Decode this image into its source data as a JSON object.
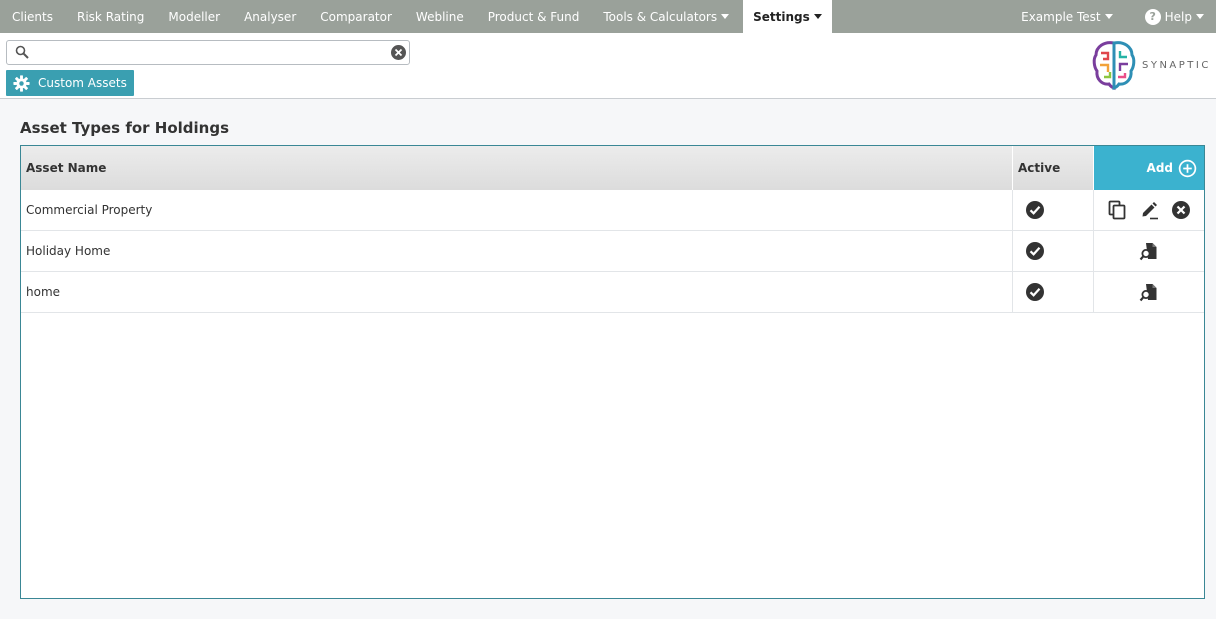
{
  "nav": {
    "items": [
      {
        "label": "Clients",
        "dropdown": false
      },
      {
        "label": "Risk Rating",
        "dropdown": false
      },
      {
        "label": "Modeller",
        "dropdown": false
      },
      {
        "label": "Analyser",
        "dropdown": false
      },
      {
        "label": "Comparator",
        "dropdown": false
      },
      {
        "label": "Webline",
        "dropdown": false
      },
      {
        "label": "Product & Fund",
        "dropdown": false
      },
      {
        "label": "Tools & Calculators",
        "dropdown": true
      }
    ],
    "active": {
      "label": "Settings"
    },
    "user": {
      "label": "Example Test"
    },
    "help": {
      "label": "Help",
      "icon_glyph": "?"
    }
  },
  "search": {
    "value": "",
    "placeholder": ""
  },
  "custom_assets_button": {
    "label": "Custom Assets"
  },
  "brand": {
    "name": "SYNAPTIC"
  },
  "page": {
    "title": "Asset Types for Holdings"
  },
  "table": {
    "headers": {
      "name": "Asset Name",
      "active": "Active",
      "add": "Add"
    },
    "rows": [
      {
        "name": "Commercial Property",
        "active": true,
        "actions": [
          "copy",
          "edit",
          "delete"
        ]
      },
      {
        "name": "Holiday Home",
        "active": true,
        "actions": [
          "view"
        ]
      },
      {
        "name": "home",
        "active": true,
        "actions": [
          "view"
        ]
      }
    ]
  },
  "colors": {
    "nav_bg": "#9aa19a",
    "accent": "#3a9fb1",
    "add_header": "#3bb2cf",
    "table_border": "#3a8795"
  }
}
